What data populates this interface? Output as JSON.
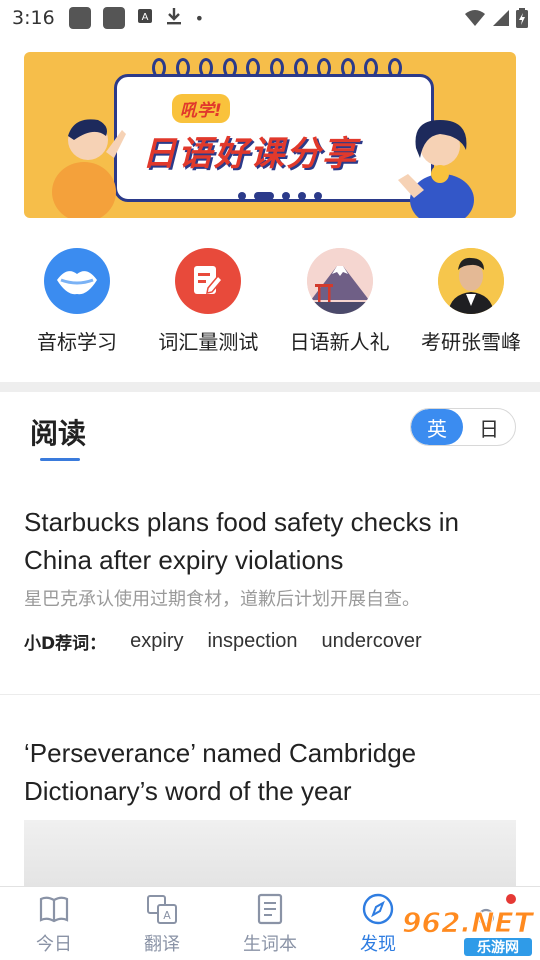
{
  "status_bar": {
    "time": "3:16",
    "dot": "•"
  },
  "banner": {
    "tag": "吼学!",
    "headline": "日语好课分享"
  },
  "quick_links": [
    {
      "label": "音标学习",
      "icon": "phonetic-lips-icon",
      "color": "#3b8cf0"
    },
    {
      "label": "词汇量测试",
      "icon": "vocab-test-icon",
      "color": "#e84a3b"
    },
    {
      "label": "日语新人礼",
      "icon": "mount-fuji-icon",
      "color": "#f3d3cf"
    },
    {
      "label": "考研张雪峰",
      "icon": "teacher-avatar",
      "color": "#f6c64c"
    }
  ],
  "reading": {
    "heading": "阅读",
    "toggle": {
      "english": "英",
      "japanese": "日"
    }
  },
  "articles": [
    {
      "title": "Starbucks plans food safety checks in China after expiry violations",
      "subtitle": "星巴克承认使用过期食材，道歉后计划开展自查。",
      "keywords_label": "小D荐词：",
      "keywords": [
        "expiry",
        "inspection",
        "undercover"
      ]
    },
    {
      "title": "‘Perseverance’ named Cambridge Dictionary’s word of the year"
    }
  ],
  "tabs": [
    {
      "label": "今日",
      "icon": "book-icon",
      "active": false
    },
    {
      "label": "翻译",
      "icon": "translate-icon",
      "active": false
    },
    {
      "label": "生词本",
      "icon": "notebook-icon",
      "active": false
    },
    {
      "label": "发现",
      "icon": "compass-icon",
      "active": true
    },
    {
      "label": "",
      "icon": "profile-icon",
      "active": false
    }
  ],
  "watermark": {
    "text": "962.NET",
    "subtext": "乐游网"
  },
  "colors": {
    "accent": "#3b8cf0",
    "tab_active": "#2f7de1",
    "tab_inactive": "#8a93a6",
    "banner_bg": "#f6be4a",
    "headline_red": "#e1392c"
  }
}
